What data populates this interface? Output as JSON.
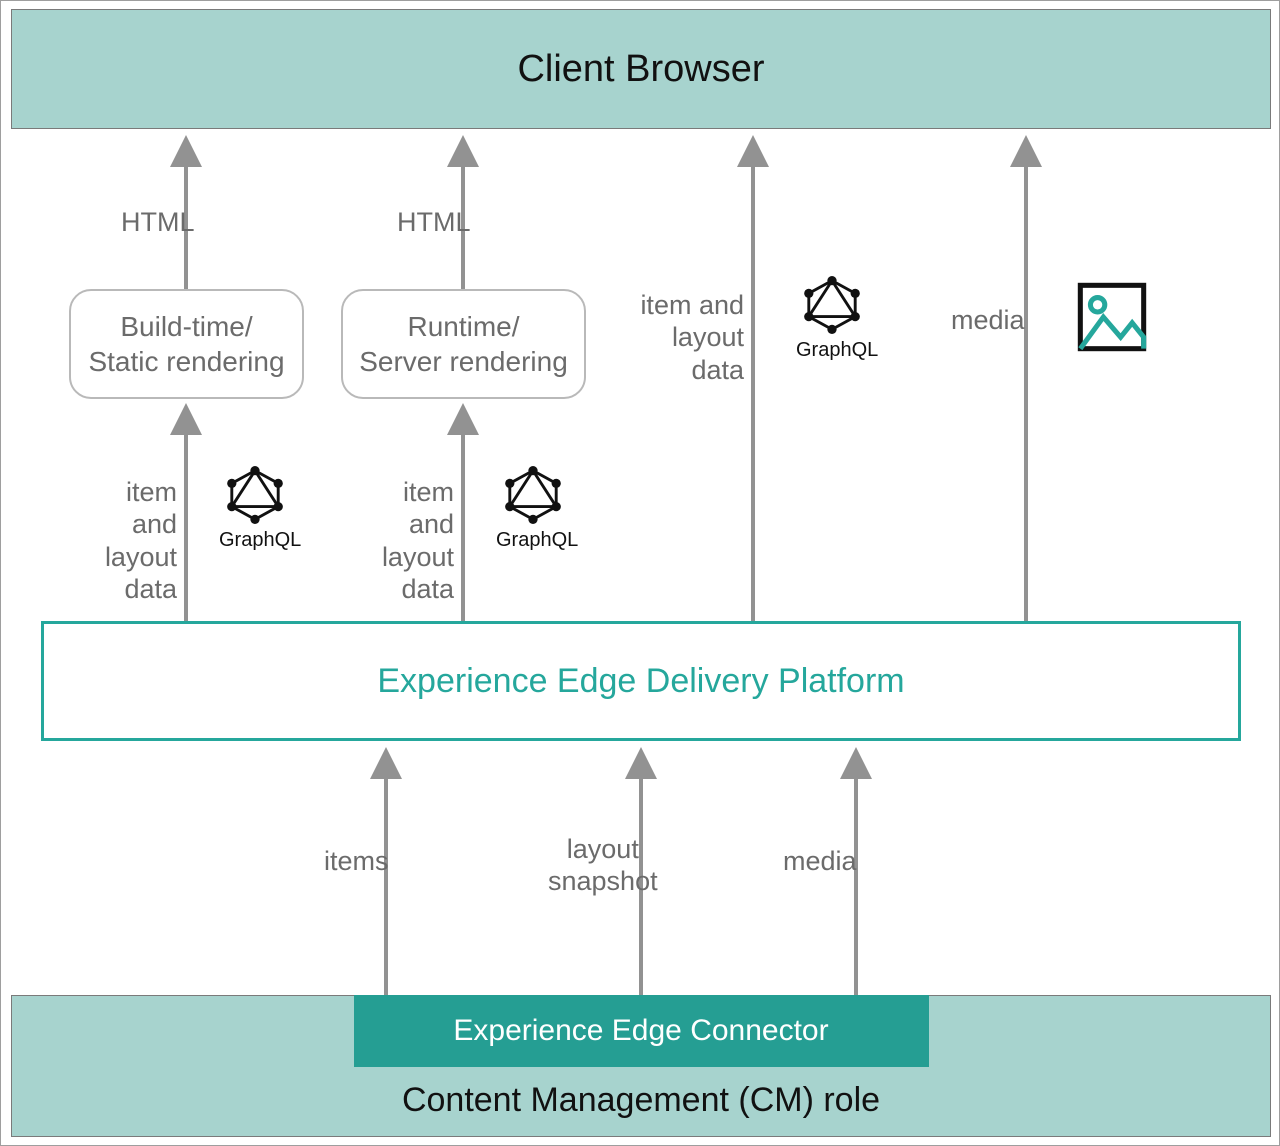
{
  "blocks": {
    "client_browser": "Client Browser",
    "build_time": "Build-time/\nStatic rendering",
    "runtime": "Runtime/\nServer rendering",
    "edge_platform": "Experience Edge Delivery Platform",
    "edge_connector": "Experience Edge Connector",
    "cm_role": "Content Management (CM) role"
  },
  "labels": {
    "html": "HTML",
    "item_layout": "item and\nlayout data",
    "items": "items",
    "layout_snapshot": "layout\nsnapshot",
    "media": "media",
    "graphql": "GraphQL"
  },
  "colors": {
    "teal_fill": "#a7d3ce",
    "teal_border": "#25a79c",
    "teal_dark": "#259e93",
    "grey": "#6b6b6b",
    "arrow": "#929292"
  }
}
